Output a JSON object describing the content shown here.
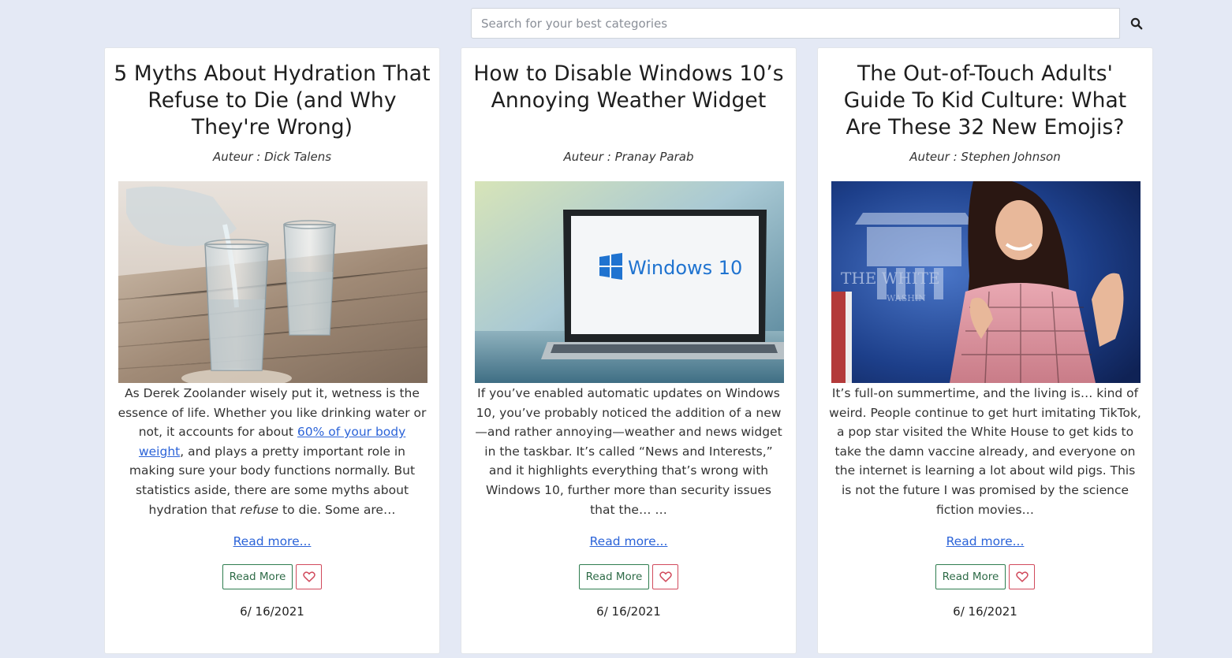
{
  "search": {
    "placeholder": "Search for your best categories",
    "icon": "search-icon"
  },
  "articles": [
    {
      "title": "5 Myths About Hydration That Refuse to Die (and Why They're Wrong)",
      "author": "Auteur : Dick Talens",
      "image": "water-glasses-image",
      "excerpt_parts": {
        "a": "As Derek Zoolander wisely put it, wetness is the essence of life. Whether you like drinking water or not, it accounts for about ",
        "link": "60% of your body weight",
        "b": ", and plays a pretty important role in making sure your body functions normally. But statistics aside, there are some myths about hydration that ",
        "em": "refuse",
        "c": " to die. Some are…"
      },
      "read_more_link": "Read more...",
      "read_more_button": "Read More",
      "like_icon": "heart-icon",
      "date": "6/ 16/2021"
    },
    {
      "title": "How to Disable Windows 10’s Annoying Weather Widget",
      "author": "Auteur : Pranay Parab",
      "image": "windows-laptop-image",
      "image_text": "Windows 10",
      "excerpt": "If you’ve enabled automatic updates on Windows 10, you’ve probably noticed the addition of a new—and rather annoying—weather and news widget in the taskbar. It’s called “News and Interests,” and it highlights everything that’s wrong with Windows 10, further more than security issues that the… …",
      "read_more_link": "Read more...",
      "read_more_button": "Read More",
      "like_icon": "heart-icon",
      "date": "6/ 16/2021"
    },
    {
      "title": "The Out-of-Touch Adults' Guide To Kid Culture: What Are These 32 New Emojis?",
      "author": "Auteur : Stephen Johnson",
      "image": "white-house-briefing-image",
      "image_text": "THE WHITE",
      "image_text_2": "WASHIN",
      "excerpt": "It’s full-on summertime, and the living is… kind of weird. People continue to get hurt imitating TikTok, a pop star visited the White House to get kids to take the damn vaccine already, and everyone on the internet is learning a lot about wild pigs. This is not the future I was promised by the science fiction movies…",
      "read_more_link": "Read more...",
      "read_more_button": "Read More",
      "like_icon": "heart-icon",
      "date": "6/ 16/2021"
    }
  ],
  "colors": {
    "background": "#e4e9f5",
    "link": "#2b63d8",
    "read_more_border": "#2e7d4f",
    "like_border": "#d14a5c"
  }
}
